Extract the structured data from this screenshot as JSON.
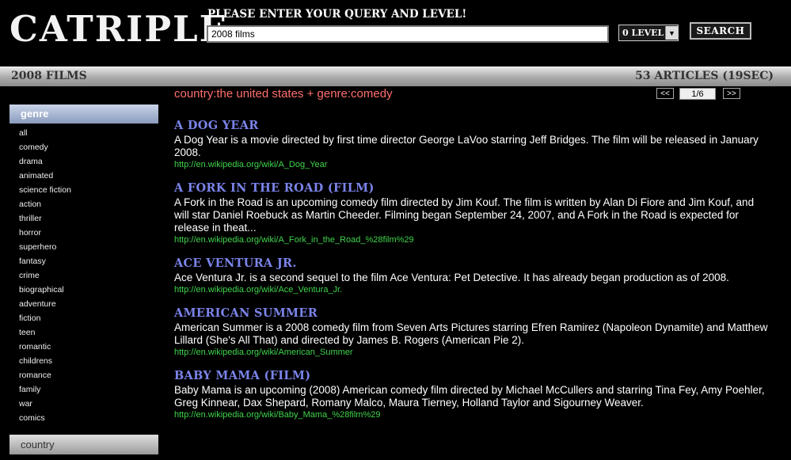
{
  "logo": "CATRIPLE",
  "prompt": "PLEASE ENTER YOUR QUERY AND LEVEL!",
  "search": {
    "value": "2008 films",
    "placeholder": ""
  },
  "level": {
    "selected": "0 LEVEL"
  },
  "search_button": "SEARCH",
  "bar": {
    "query_title": "2008 FILMS",
    "count": "53 ARTICLES (19SEC)"
  },
  "sidebar": {
    "header": "genre",
    "items": [
      "all",
      "comedy",
      "drama",
      "animated",
      "science fiction",
      "action",
      "thriller",
      "horror",
      "superhero",
      "fantasy",
      "crime",
      "biographical",
      "adventure",
      "fiction",
      "teen",
      "romantic",
      "childrens",
      "romance",
      "family",
      "war",
      "comics"
    ],
    "footer": "country"
  },
  "facet": "country:the united states + genre:comedy",
  "pager": {
    "prev": "<<",
    "page": "1/6",
    "next": ">>"
  },
  "results": [
    {
      "title": "A DOG YEAR",
      "desc": "A Dog Year is a movie directed by first time director George LaVoo starring Jeff Bridges. The film will be released in January 2008.",
      "url": "http://en.wikipedia.org/wiki/A_Dog_Year"
    },
    {
      "title": "A FORK IN THE ROAD (FILM)",
      "desc": "A Fork in the Road is an upcoming comedy film directed by Jim Kouf. The film is written by Alan Di Fiore and Jim Kouf, and will star Daniel Roebuck as Martin Cheeder. Filming began September 24, 2007, and A Fork in the Road is expected for release in theat...",
      "url": "http://en.wikipedia.org/wiki/A_Fork_in_the_Road_%28film%29"
    },
    {
      "title": "ACE VENTURA JR.",
      "desc": "Ace Ventura Jr. is a second sequel to the film Ace Ventura: Pet Detective. It has already began production as of 2008.",
      "url": "http://en.wikipedia.org/wiki/Ace_Ventura_Jr."
    },
    {
      "title": "AMERICAN SUMMER",
      "desc": "American Summer is a 2008 comedy film from Seven Arts Pictures starring Efren Ramirez (Napoleon Dynamite) and Matthew Lillard (She's All That) and directed by James B. Rogers (American Pie 2).",
      "url": "http://en.wikipedia.org/wiki/American_Summer"
    },
    {
      "title": "BABY MAMA (FILM)",
      "desc": "Baby Mama is an upcoming (2008) American comedy film directed by Michael McCullers and starring Tina Fey, Amy Poehler, Greg Kinnear, Dax Shepard, Romany Malco, Maura Tierney, Holland Taylor and Sigourney Weaver.",
      "url": "http://en.wikipedia.org/wiki/Baby_Mama_%28film%29"
    }
  ]
}
